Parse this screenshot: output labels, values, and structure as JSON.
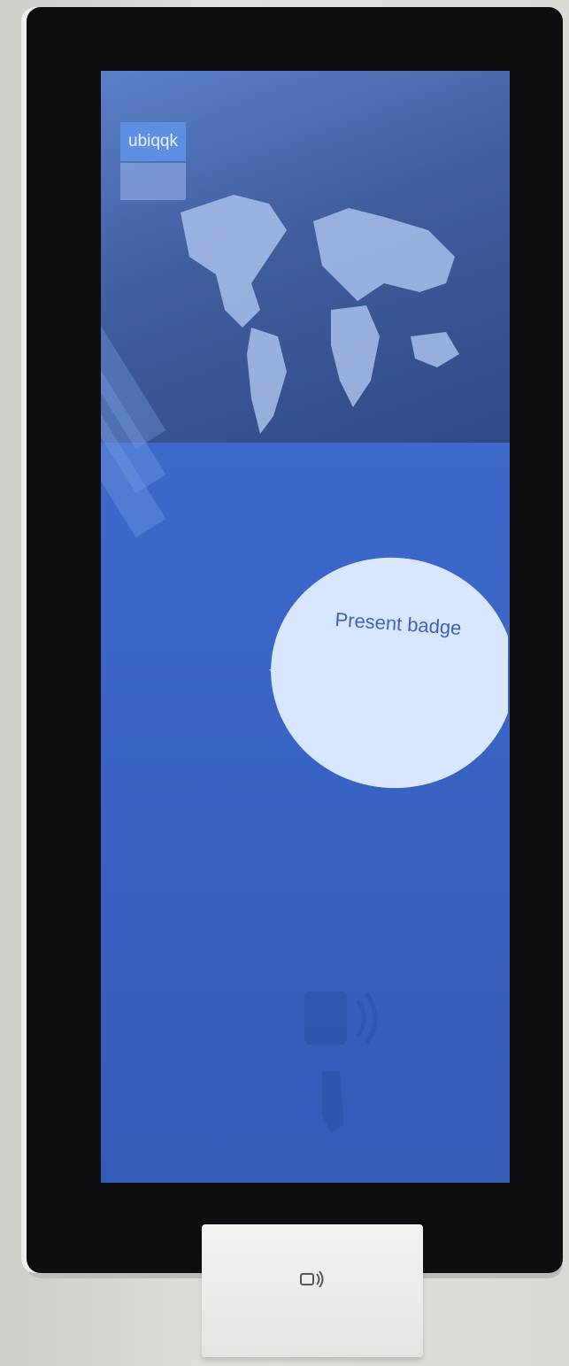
{
  "kiosk": {
    "logo_text": "ubiqqk",
    "prompt_text": "Present badge"
  },
  "icons": {
    "map": "world-map-icon",
    "badge": "badge-tap-icon",
    "nfc": "contactless-card-icon"
  },
  "colors": {
    "screen_blue": "#3a66c8",
    "bubble": "#d9e6ff",
    "bezel": "#0e0e10"
  }
}
